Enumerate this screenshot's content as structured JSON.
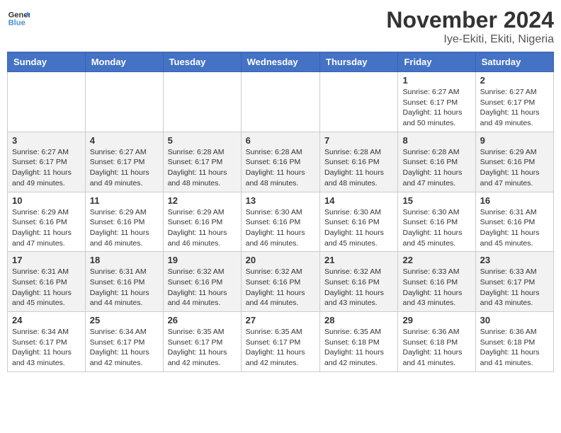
{
  "header": {
    "logo_general": "General",
    "logo_blue": "Blue",
    "month_title": "November 2024",
    "location": "Iye-Ekiti, Ekiti, Nigeria"
  },
  "weekdays": [
    "Sunday",
    "Monday",
    "Tuesday",
    "Wednesday",
    "Thursday",
    "Friday",
    "Saturday"
  ],
  "weeks": [
    [
      {
        "day": "",
        "info": ""
      },
      {
        "day": "",
        "info": ""
      },
      {
        "day": "",
        "info": ""
      },
      {
        "day": "",
        "info": ""
      },
      {
        "day": "",
        "info": ""
      },
      {
        "day": "1",
        "info": "Sunrise: 6:27 AM\nSunset: 6:17 PM\nDaylight: 11 hours and 50 minutes."
      },
      {
        "day": "2",
        "info": "Sunrise: 6:27 AM\nSunset: 6:17 PM\nDaylight: 11 hours and 49 minutes."
      }
    ],
    [
      {
        "day": "3",
        "info": "Sunrise: 6:27 AM\nSunset: 6:17 PM\nDaylight: 11 hours and 49 minutes."
      },
      {
        "day": "4",
        "info": "Sunrise: 6:27 AM\nSunset: 6:17 PM\nDaylight: 11 hours and 49 minutes."
      },
      {
        "day": "5",
        "info": "Sunrise: 6:28 AM\nSunset: 6:17 PM\nDaylight: 11 hours and 48 minutes."
      },
      {
        "day": "6",
        "info": "Sunrise: 6:28 AM\nSunset: 6:16 PM\nDaylight: 11 hours and 48 minutes."
      },
      {
        "day": "7",
        "info": "Sunrise: 6:28 AM\nSunset: 6:16 PM\nDaylight: 11 hours and 48 minutes."
      },
      {
        "day": "8",
        "info": "Sunrise: 6:28 AM\nSunset: 6:16 PM\nDaylight: 11 hours and 47 minutes."
      },
      {
        "day": "9",
        "info": "Sunrise: 6:29 AM\nSunset: 6:16 PM\nDaylight: 11 hours and 47 minutes."
      }
    ],
    [
      {
        "day": "10",
        "info": "Sunrise: 6:29 AM\nSunset: 6:16 PM\nDaylight: 11 hours and 47 minutes."
      },
      {
        "day": "11",
        "info": "Sunrise: 6:29 AM\nSunset: 6:16 PM\nDaylight: 11 hours and 46 minutes."
      },
      {
        "day": "12",
        "info": "Sunrise: 6:29 AM\nSunset: 6:16 PM\nDaylight: 11 hours and 46 minutes."
      },
      {
        "day": "13",
        "info": "Sunrise: 6:30 AM\nSunset: 6:16 PM\nDaylight: 11 hours and 46 minutes."
      },
      {
        "day": "14",
        "info": "Sunrise: 6:30 AM\nSunset: 6:16 PM\nDaylight: 11 hours and 45 minutes."
      },
      {
        "day": "15",
        "info": "Sunrise: 6:30 AM\nSunset: 6:16 PM\nDaylight: 11 hours and 45 minutes."
      },
      {
        "day": "16",
        "info": "Sunrise: 6:31 AM\nSunset: 6:16 PM\nDaylight: 11 hours and 45 minutes."
      }
    ],
    [
      {
        "day": "17",
        "info": "Sunrise: 6:31 AM\nSunset: 6:16 PM\nDaylight: 11 hours and 45 minutes."
      },
      {
        "day": "18",
        "info": "Sunrise: 6:31 AM\nSunset: 6:16 PM\nDaylight: 11 hours and 44 minutes."
      },
      {
        "day": "19",
        "info": "Sunrise: 6:32 AM\nSunset: 6:16 PM\nDaylight: 11 hours and 44 minutes."
      },
      {
        "day": "20",
        "info": "Sunrise: 6:32 AM\nSunset: 6:16 PM\nDaylight: 11 hours and 44 minutes."
      },
      {
        "day": "21",
        "info": "Sunrise: 6:32 AM\nSunset: 6:16 PM\nDaylight: 11 hours and 43 minutes."
      },
      {
        "day": "22",
        "info": "Sunrise: 6:33 AM\nSunset: 6:16 PM\nDaylight: 11 hours and 43 minutes."
      },
      {
        "day": "23",
        "info": "Sunrise: 6:33 AM\nSunset: 6:17 PM\nDaylight: 11 hours and 43 minutes."
      }
    ],
    [
      {
        "day": "24",
        "info": "Sunrise: 6:34 AM\nSunset: 6:17 PM\nDaylight: 11 hours and 43 minutes."
      },
      {
        "day": "25",
        "info": "Sunrise: 6:34 AM\nSunset: 6:17 PM\nDaylight: 11 hours and 42 minutes."
      },
      {
        "day": "26",
        "info": "Sunrise: 6:35 AM\nSunset: 6:17 PM\nDaylight: 11 hours and 42 minutes."
      },
      {
        "day": "27",
        "info": "Sunrise: 6:35 AM\nSunset: 6:17 PM\nDaylight: 11 hours and 42 minutes."
      },
      {
        "day": "28",
        "info": "Sunrise: 6:35 AM\nSunset: 6:18 PM\nDaylight: 11 hours and 42 minutes."
      },
      {
        "day": "29",
        "info": "Sunrise: 6:36 AM\nSunset: 6:18 PM\nDaylight: 11 hours and 41 minutes."
      },
      {
        "day": "30",
        "info": "Sunrise: 6:36 AM\nSunset: 6:18 PM\nDaylight: 11 hours and 41 minutes."
      }
    ]
  ]
}
